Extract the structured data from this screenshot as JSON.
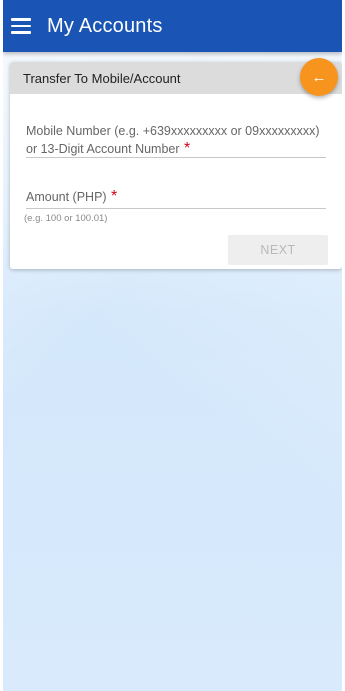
{
  "appbar": {
    "title": "My Accounts",
    "menu_icon": "hamburger-menu-icon",
    "background": "#1a55b5"
  },
  "card": {
    "header_title": "Transfer To Mobile/Account",
    "back_icon": "arrow-left-icon",
    "back_glyph": "←",
    "back_color": "#f7941d",
    "mobile_field": {
      "label": "Mobile Number (e.g. +639xxxxxxxxx or 09xxxxxxxxx) or 13-Digit Account Number",
      "required_mark": "*",
      "value": ""
    },
    "amount_field": {
      "label": "Amount (PHP)",
      "required_mark": "*",
      "hint": "(e.g. 100 or 100.01)",
      "value": ""
    },
    "next_label": "NEXT"
  }
}
